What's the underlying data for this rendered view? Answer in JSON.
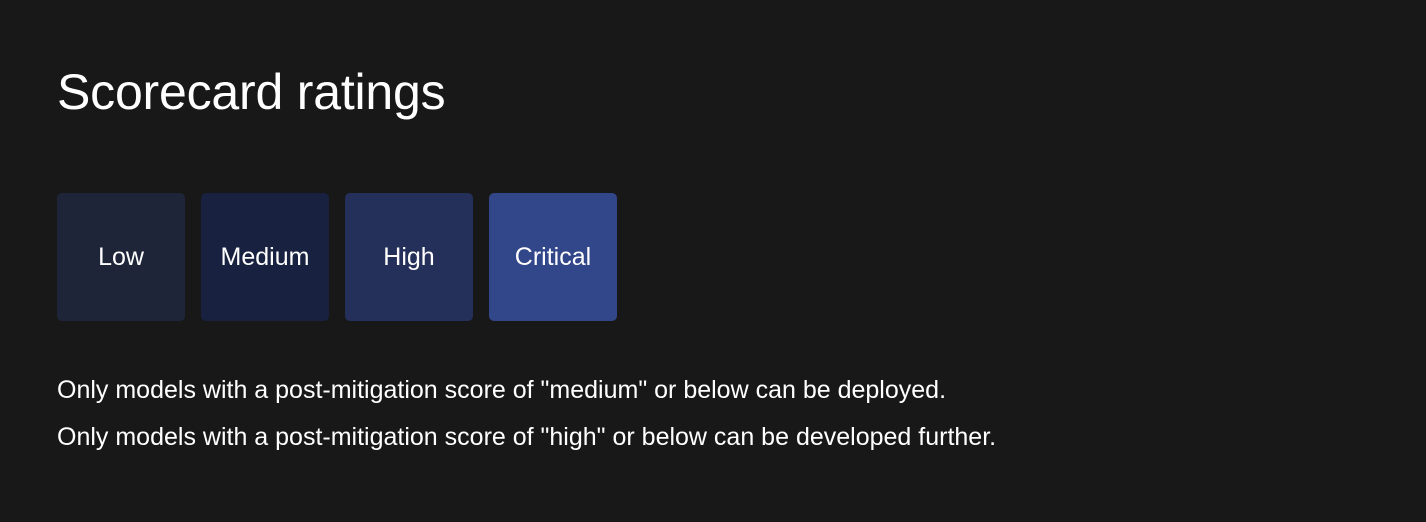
{
  "title": "Scorecard ratings",
  "ratings": [
    {
      "label": "Low",
      "color": "#1F2539"
    },
    {
      "label": "Medium",
      "color": "#18213F"
    },
    {
      "label": "High",
      "color": "#25305A"
    },
    {
      "label": "Critical",
      "color": "#32468A"
    }
  ],
  "notes": [
    "Only models with a post-mitigation score of \"medium\" or below can be deployed.",
    "Only models with a post-mitigation score of \"high\" or below can be developed further."
  ]
}
